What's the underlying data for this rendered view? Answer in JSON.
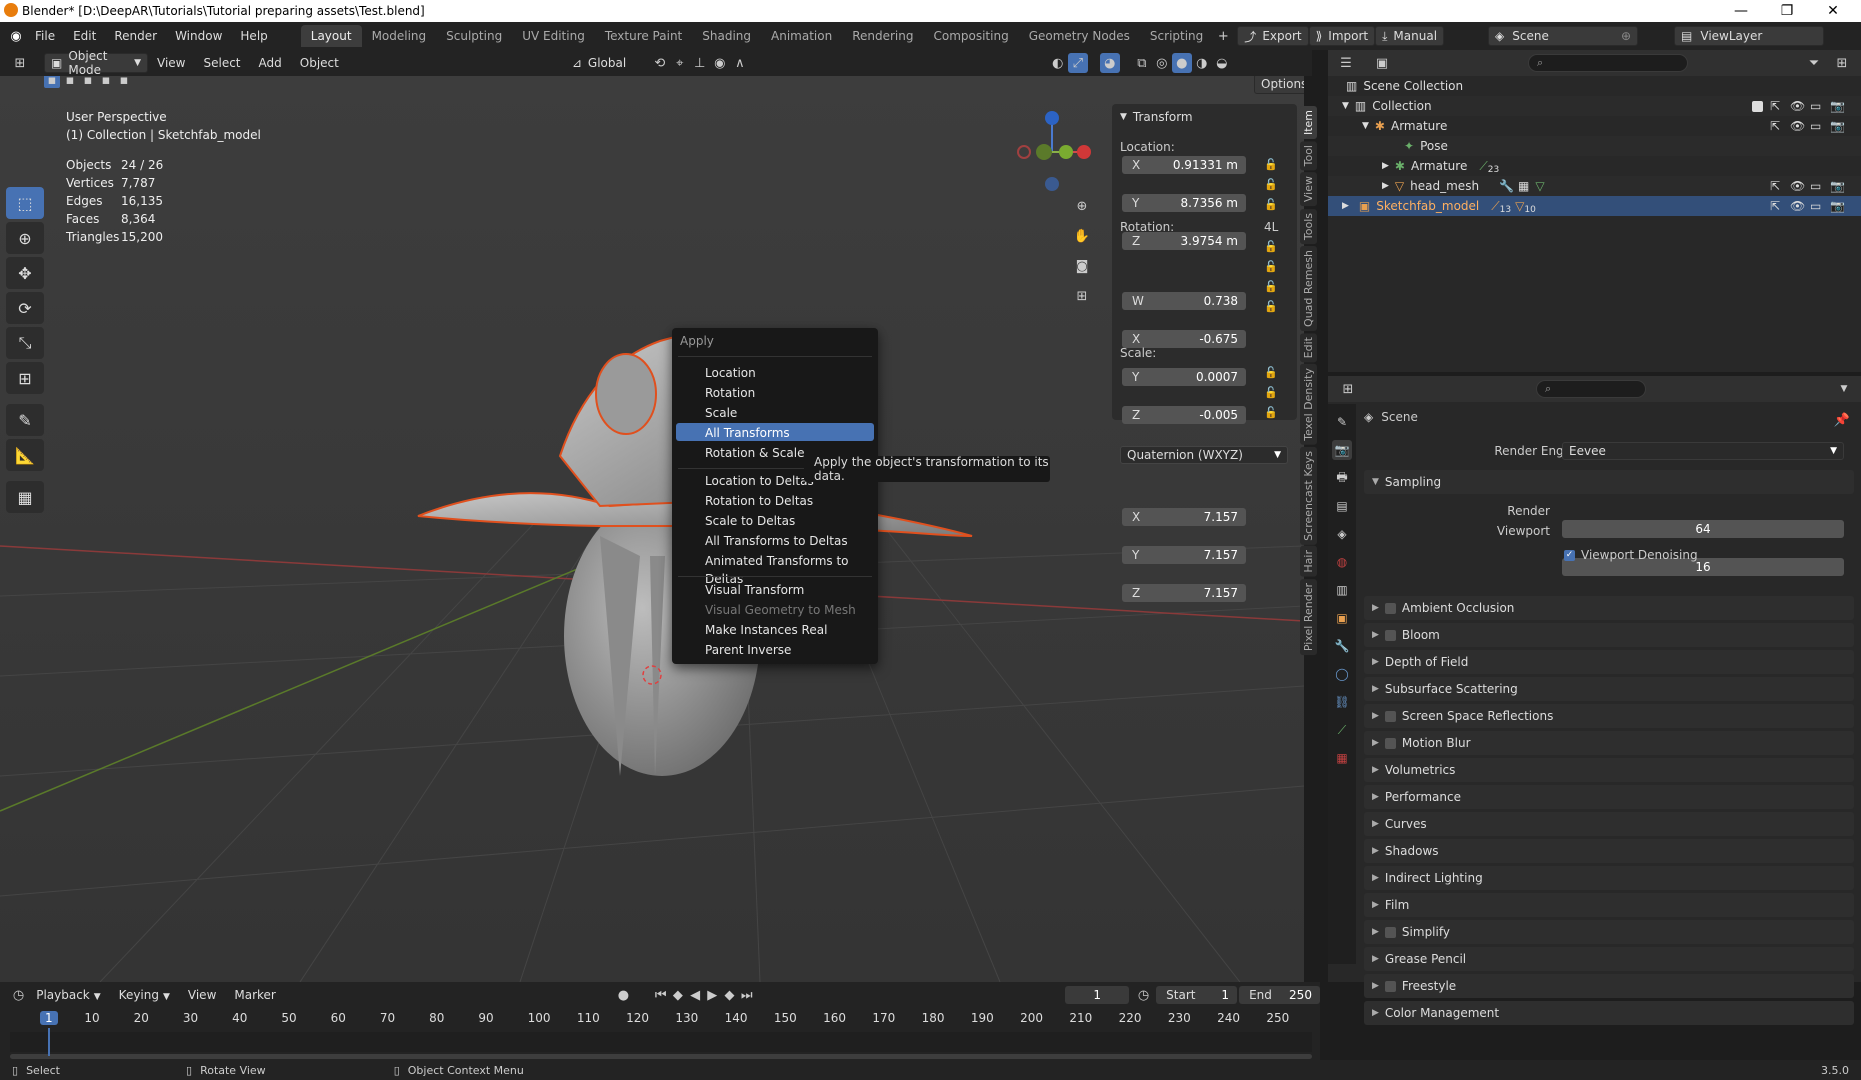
{
  "titlebar": {
    "title": "Blender* [D:\\DeepAR\\Tutorials\\Tutorial preparing assets\\Test.blend]"
  },
  "menu": [
    "File",
    "Edit",
    "Render",
    "Window",
    "Help"
  ],
  "workspaces": [
    "Layout",
    "Modeling",
    "Sculpting",
    "UV Editing",
    "Texture Paint",
    "Shading",
    "Animation",
    "Rendering",
    "Compositing",
    "Geometry Nodes",
    "Scripting"
  ],
  "top_right": {
    "export": "Export",
    "import": "Import",
    "manual": "Manual",
    "scene": "Scene",
    "viewlayer": "ViewLayer"
  },
  "viewport_header": {
    "mode": "Object Mode",
    "view": "View",
    "select": "Select",
    "add": "Add",
    "object": "Object",
    "orientation": "Global",
    "options": "Options"
  },
  "overlay": {
    "perspective": "User Perspective",
    "collection": "(1) Collection | Sketchfab_model",
    "stats": [
      {
        "label": "Objects",
        "value": "24 / 26"
      },
      {
        "label": "Vertices",
        "value": "7,787"
      },
      {
        "label": "Edges",
        "value": "16,135"
      },
      {
        "label": "Faces",
        "value": "8,364"
      },
      {
        "label": "Triangles",
        "value": "15,200"
      }
    ]
  },
  "transform": {
    "title": "Transform",
    "location_label": "Location:",
    "location": [
      {
        "axis": "X",
        "value": "0.91331 m"
      },
      {
        "axis": "Y",
        "value": "8.7356 m"
      },
      {
        "axis": "Z",
        "value": "3.9754 m"
      }
    ],
    "rotation_label": "Rotation:",
    "rotation_mode_short": "4L",
    "rotation": [
      {
        "axis": "W",
        "value": "0.738"
      },
      {
        "axis": "X",
        "value": "-0.675"
      },
      {
        "axis": "Y",
        "value": "0.0007"
      },
      {
        "axis": "Z",
        "value": "-0.005"
      }
    ],
    "rotation_mode": "Quaternion (WXYZ)",
    "scale_label": "Scale:",
    "scale": [
      {
        "axis": "X",
        "value": "7.157"
      },
      {
        "axis": "Y",
        "value": "7.157"
      },
      {
        "axis": "Z",
        "value": "7.157"
      }
    ]
  },
  "side_tabs": [
    "Item",
    "Tool",
    "View",
    "Tools",
    "Quad Remesh",
    "Edit",
    "Texel Density",
    "Screencast Keys",
    "Hair",
    "Pixel Render"
  ],
  "context_menu": {
    "title": "Apply",
    "items": [
      "Location",
      "Rotation",
      "Scale",
      "All Transforms",
      "Rotation & Scale",
      "Location to Deltas",
      "Rotation to Deltas",
      "Scale to Deltas",
      "All Transforms to Deltas",
      "Animated Transforms to Deltas",
      "Visual Transform",
      "Visual Geometry to Mesh",
      "Make Instances Real",
      "Parent Inverse"
    ],
    "tooltip": "Apply the object's transformation to its data."
  },
  "outliner": {
    "rows": [
      "Scene Collection",
      "Collection",
      "Armature",
      "Pose",
      "Armature",
      "head_mesh",
      "Sketchfab_model"
    ],
    "badges": {
      "armature_count": "23",
      "sketch_a": "13",
      "sketch_b": "10"
    }
  },
  "properties": {
    "context": "Scene",
    "render_engine_label": "Render Engine",
    "render_engine": "Eevee",
    "sampling": "Sampling",
    "render_label": "Render",
    "render_value": "64",
    "viewport_label": "Viewport",
    "viewport_value": "16",
    "denoise": "Viewport Denoising",
    "sections": [
      {
        "label": "Ambient Occlusion",
        "checkbox": true
      },
      {
        "label": "Bloom",
        "checkbox": true
      },
      {
        "label": "Depth of Field",
        "checkbox": false
      },
      {
        "label": "Subsurface Scattering",
        "checkbox": false
      },
      {
        "label": "Screen Space Reflections",
        "checkbox": true
      },
      {
        "label": "Motion Blur",
        "checkbox": true
      },
      {
        "label": "Volumetrics",
        "checkbox": false
      },
      {
        "label": "Performance",
        "checkbox": false
      },
      {
        "label": "Curves",
        "checkbox": false
      },
      {
        "label": "Shadows",
        "checkbox": false
      },
      {
        "label": "Indirect Lighting",
        "checkbox": false
      },
      {
        "label": "Film",
        "checkbox": false
      },
      {
        "label": "Simplify",
        "checkbox": true
      },
      {
        "label": "Grease Pencil",
        "checkbox": false
      },
      {
        "label": "Freestyle",
        "checkbox": true
      },
      {
        "label": "Color Management",
        "checkbox": false
      }
    ]
  },
  "timeline": {
    "playback": "Playback",
    "keying": "Keying",
    "view": "View",
    "marker": "Marker",
    "current_frame": "1",
    "start_label": "Start",
    "start": "1",
    "end_label": "End",
    "end": "250",
    "ruler": [
      "1",
      "10",
      "20",
      "30",
      "40",
      "50",
      "60",
      "70",
      "80",
      "90",
      "100",
      "110",
      "120",
      "130",
      "140",
      "150",
      "160",
      "170",
      "180",
      "190",
      "200",
      "210",
      "220",
      "230",
      "240",
      "250"
    ]
  },
  "statusbar": {
    "select": "Select",
    "rotate": "Rotate View",
    "context": "Object Context Menu",
    "version": "3.5.0"
  }
}
